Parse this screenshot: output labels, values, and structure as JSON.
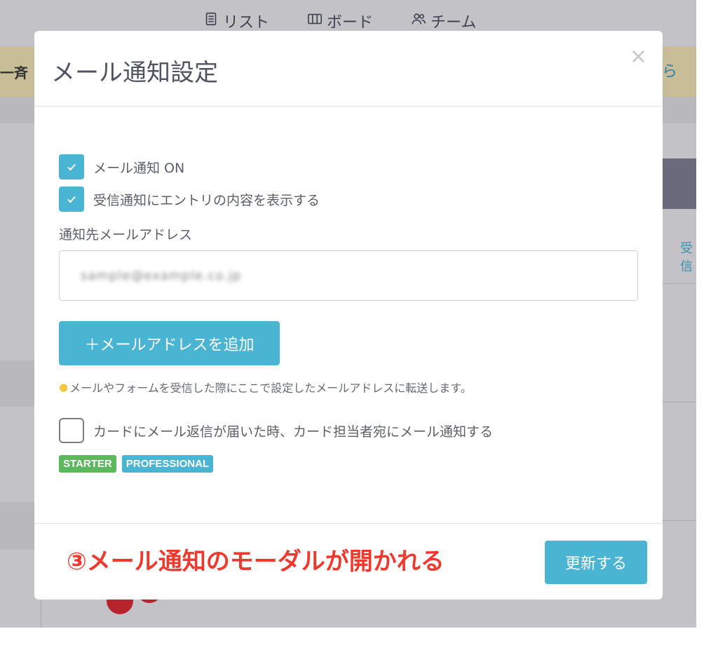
{
  "background": {
    "nav": [
      {
        "label": "リスト",
        "icon": "document-list-icon"
      },
      {
        "label": "ボード",
        "icon": "board-columns-icon"
      },
      {
        "label": "チーム",
        "icon": "team-users-icon"
      }
    ],
    "banner_left_text": "一斉",
    "banner_right_text": "ら",
    "side_text": "受信"
  },
  "modal": {
    "title": "メール通知設定",
    "close_label": "×",
    "options": {
      "email_on": {
        "label": "メール通知 ON",
        "checked": true
      },
      "show_content": {
        "label": "受信通知にエントリの内容を表示する",
        "checked": true
      },
      "notify_assignee": {
        "label": "カードにメール返信が届いた時、カード担当者宛にメール通知する",
        "checked": false
      }
    },
    "recipient_label": "通知先メールアドレス",
    "email_value": "sample@example.co.jp",
    "add_button_label": "＋メールアドレスを追加",
    "hint_text": "メールやフォームを受信した際にここで設定したメールアドレスに転送します。",
    "hint_icon": "lightbulb-icon",
    "badges": {
      "starter": "STARTER",
      "professional": "PROFESSIONAL"
    },
    "update_button_label": "更新する"
  },
  "annotation": "③メール通知のモーダルが開かれる",
  "colors": {
    "accent": "#4ab5d2",
    "starter_badge": "#5cb85c",
    "annotation": "#ee3a2e",
    "overlay": "#c3c2c7"
  }
}
